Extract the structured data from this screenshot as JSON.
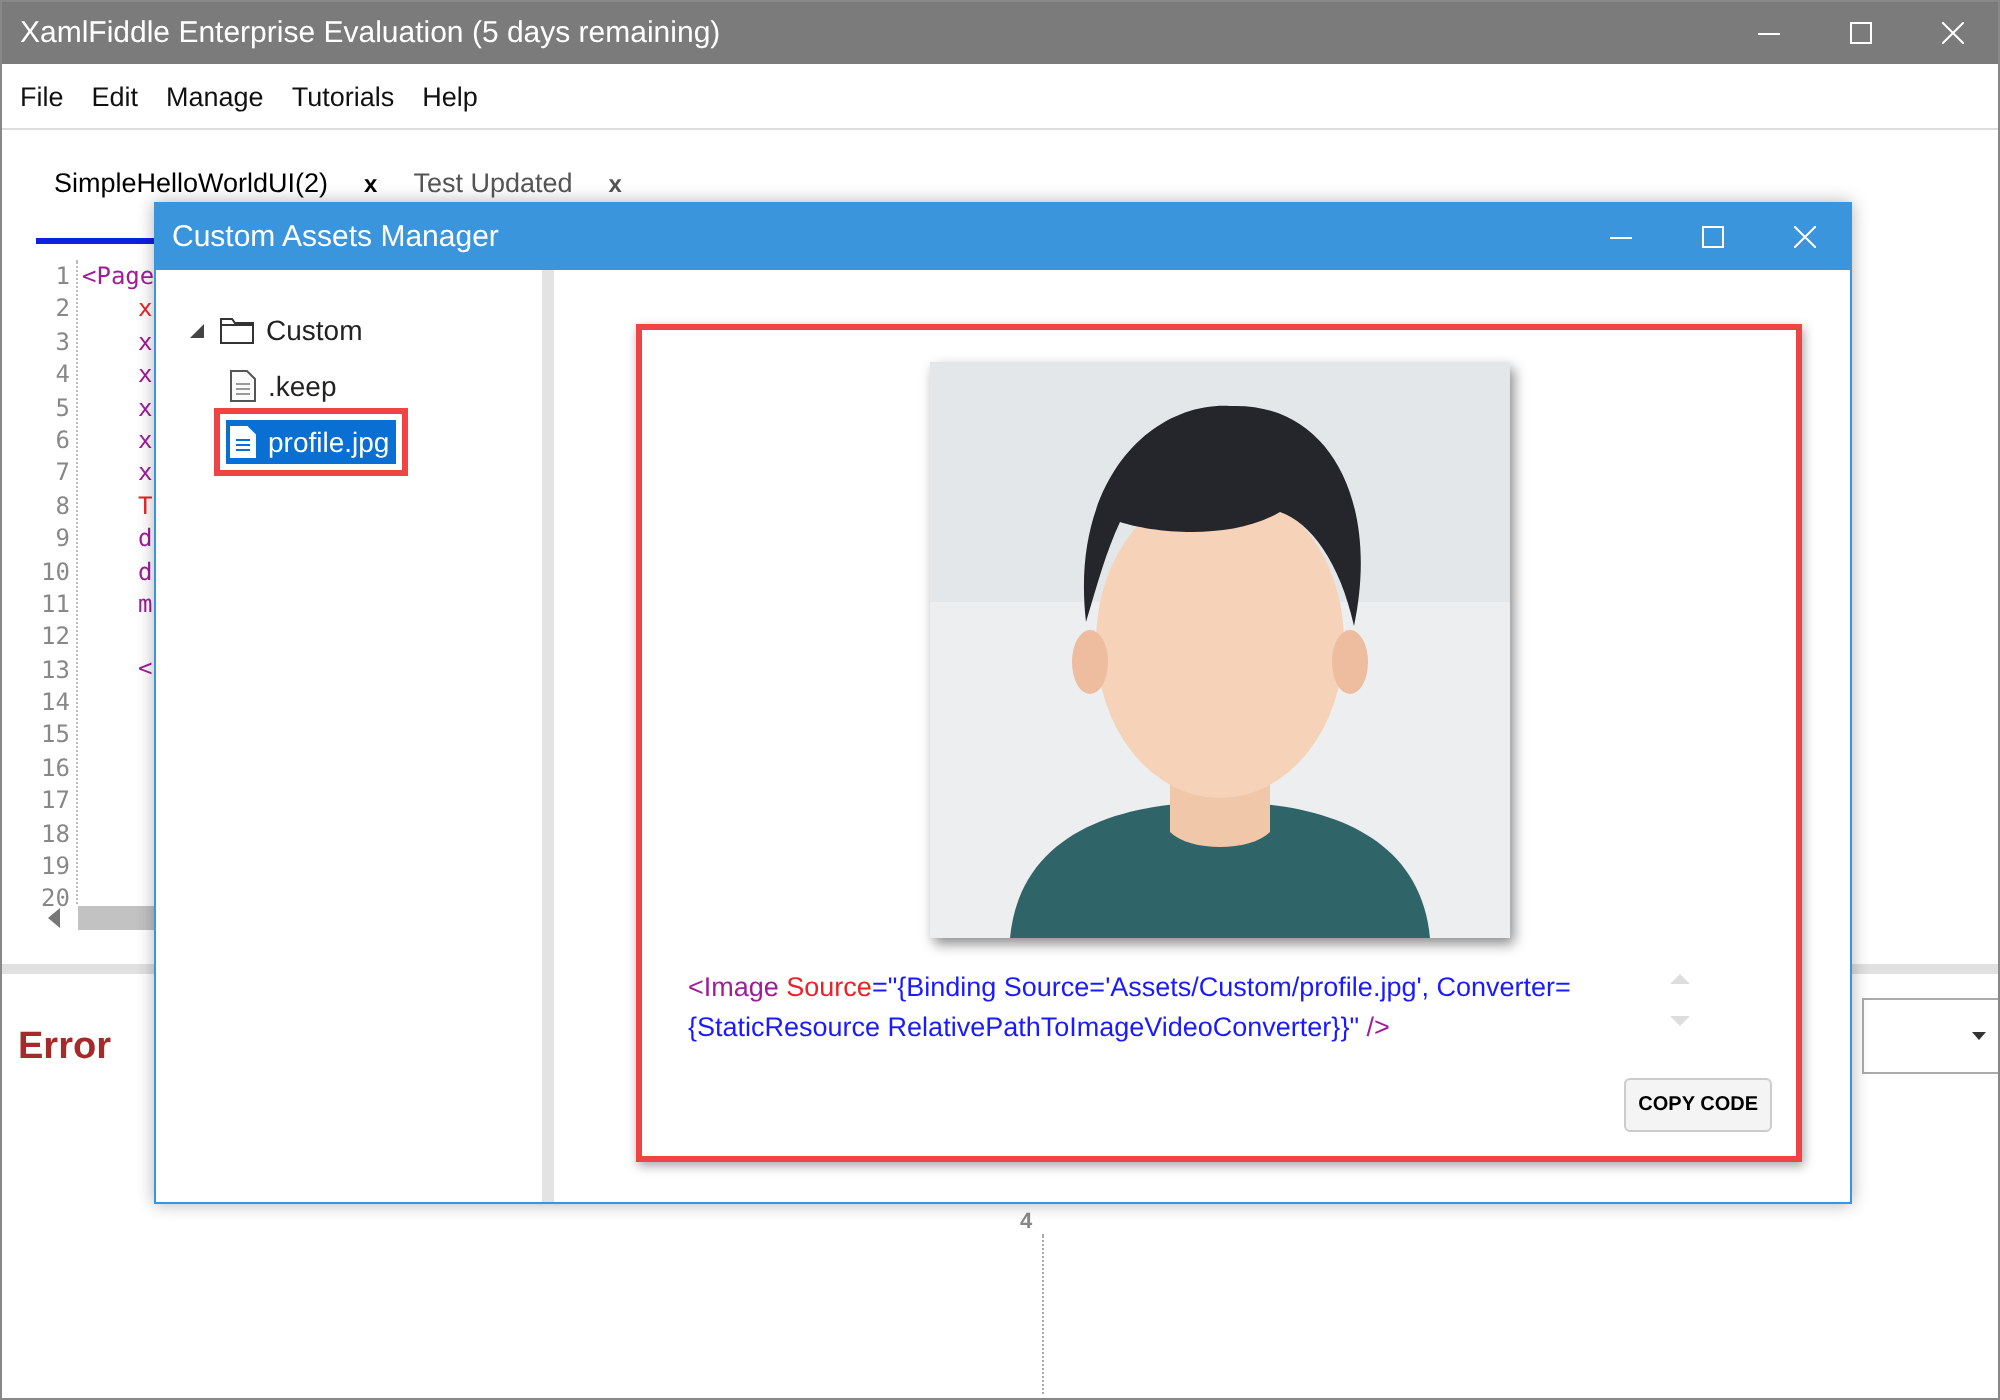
{
  "window": {
    "title": "XamlFiddle Enterprise Evaluation (5 days remaining)"
  },
  "menu": [
    "File",
    "Edit",
    "Manage",
    "Tutorials",
    "Help"
  ],
  "tabs": [
    {
      "label": "SimpleHelloWorldUI(2)",
      "close": "x",
      "selected": true
    },
    {
      "label": "Test Updated",
      "close": "x",
      "selected": false
    }
  ],
  "editor": {
    "lines": [
      {
        "number": "1",
        "text": "<Page",
        "kind": "tag"
      },
      {
        "number": "2",
        "text": "x",
        "kind": "attribute"
      },
      {
        "number": "3",
        "text": "x",
        "kind": "tag"
      },
      {
        "number": "4",
        "text": "x",
        "kind": "tag"
      },
      {
        "number": "5",
        "text": "x",
        "kind": "tag"
      },
      {
        "number": "6",
        "text": "x",
        "kind": "tag"
      },
      {
        "number": "7",
        "text": "x",
        "kind": "tag"
      },
      {
        "number": "8",
        "text": "T",
        "kind": "attribute"
      },
      {
        "number": "9",
        "text": "d",
        "kind": "tag"
      },
      {
        "number": "10",
        "text": "d",
        "kind": "tag"
      },
      {
        "number": "11",
        "text": "m",
        "kind": "tag"
      },
      {
        "number": "12"
      },
      {
        "number": "13",
        "text": "<",
        "kind": "tag"
      },
      {
        "number": "14"
      },
      {
        "number": "15"
      },
      {
        "number": "16"
      },
      {
        "number": "17"
      },
      {
        "number": "18"
      },
      {
        "number": "19"
      },
      {
        "number": "20"
      }
    ]
  },
  "error_panel": {
    "title": "Error",
    "marker": "4"
  },
  "dialog": {
    "title": "Custom Assets Manager",
    "tree": [
      {
        "label": "Custom",
        "kind": "folder",
        "expanded": true,
        "selected": false,
        "children": [
          {
            "label": ".keep",
            "kind": "file",
            "selected": false
          },
          {
            "label": "profile.jpg",
            "kind": "file",
            "selected": true
          }
        ]
      }
    ],
    "preview": {
      "kind": "picture"
    },
    "snippet": [
      [
        {
          "text": "<Image",
          "kind": "tag"
        },
        {
          "text": " Source",
          "kind": "attribute"
        },
        {
          "text": "=\"{Binding Source='Assets/Custom/profile.jpg', Converter=",
          "kind": "value"
        }
      ],
      [
        {
          "text": "{StaticResource RelativePathToImageVideoConverter}}\"",
          "kind": "value"
        },
        {
          "text": " />",
          "kind": "tag"
        }
      ]
    ],
    "copy_button": "COPY CODE"
  }
}
